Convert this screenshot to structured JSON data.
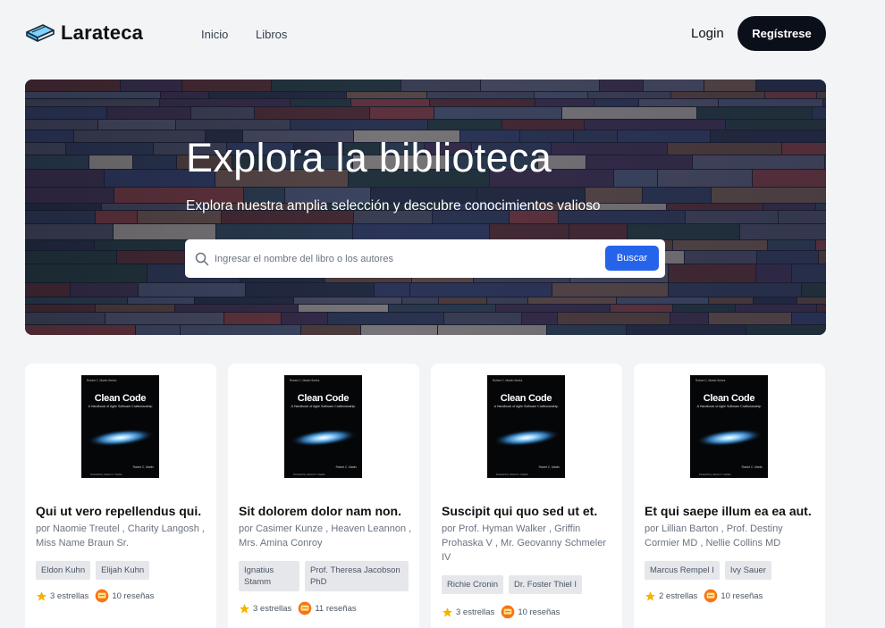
{
  "brand": {
    "name": "Larateca"
  },
  "nav": {
    "links": [
      "Inicio",
      "Libros"
    ],
    "login": "Login",
    "register": "Regístrese"
  },
  "hero": {
    "title": "Explora la biblioteca",
    "subtitle": "Explora nuestra amplia selección y descubre conocimientos valioso",
    "search_placeholder": "Ingresar el nombre del libro o los autores",
    "search_button": "Buscar"
  },
  "cover": {
    "author": "Robert C. Martin Series",
    "title": "Clean Code",
    "subtitle": "A Handbook of Agile Software Craftsmanship",
    "byline": "Robert C. Martin",
    "foreword": "Foreword by James O. Coplien"
  },
  "books": [
    {
      "title": "Qui ut vero repellendus qui.",
      "authors": "por Naomie Treutel , Charity Langosh , Miss Name Braun Sr.",
      "tags": [
        "Eldon Kuhn",
        "Elijah Kuhn"
      ],
      "stars": "3 estrellas",
      "reviews": "10 reseñas"
    },
    {
      "title": "Sit dolorem dolor nam non.",
      "authors": "por Casimer Kunze , Heaven Leannon , Mrs. Amina Conroy",
      "tags": [
        "Ignatius Stamm",
        "Prof. Theresa Jacobson PhD"
      ],
      "stars": "3 estrellas",
      "reviews": "11 reseñas"
    },
    {
      "title": "Suscipit qui quo sed ut et.",
      "authors": "por Prof. Hyman Walker , Griffin Prohaska V , Mr. Geovanny Schmeler IV",
      "tags": [
        "Richie Cronin",
        "Dr. Foster Thiel I"
      ],
      "stars": "3 estrellas",
      "reviews": "10 reseñas"
    },
    {
      "title": "Et qui saepe illum ea ea aut.",
      "authors": "por Lillian Barton , Prof. Destiny Cormier MD , Nellie Collins MD",
      "tags": [
        "Marcus Rempel I",
        "Ivy Sauer"
      ],
      "stars": "2 estrellas",
      "reviews": "10 reseñas"
    }
  ],
  "colors": {
    "primary": "#2563eb",
    "dark": "#0b0f1a",
    "star": "#f5b301",
    "review": "#f97316"
  }
}
